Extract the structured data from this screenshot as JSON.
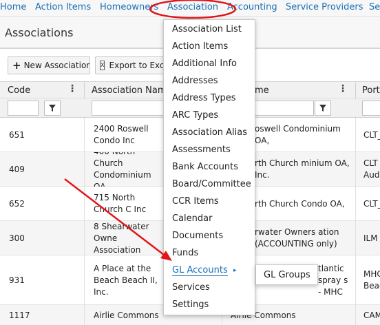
{
  "nav": {
    "items": [
      "Home",
      "Action Items",
      "Homeowners",
      "Association",
      "Accounting",
      "Service Providers",
      "Se"
    ],
    "accent": "#1a6fb5"
  },
  "page": {
    "title": "Associations"
  },
  "toolbar": {
    "new_label": "New Association",
    "export_label": "Export to Exce"
  },
  "table": {
    "columns": [
      "Code",
      "Association Name",
      "me",
      "Port"
    ],
    "rows": [
      {
        "code": "651",
        "name": "2400 Roswell Condo Inc",
        "name2": "oswell Condominium OA,",
        "port": "CLT_"
      },
      {
        "code": "409",
        "name": "400 North Church Condominium OA,",
        "name2": "rth Church minium OA, Inc.",
        "port": "CLT Audi"
      },
      {
        "code": "652",
        "name": "715 North Church C Inc",
        "name2": "rth Church Condo OA,",
        "port": "CLT_"
      },
      {
        "code": "300",
        "name": "8 Shearwater Owne Association",
        "name2": "rwater Owners ation (ACCOUNTING only)",
        "port": "ILM"
      },
      {
        "code": "931",
        "name": "A Place at the Beach Beach II, Inc.",
        "name2": "tlantic spray s - MHC",
        "port": "MHC Beac"
      },
      {
        "code": "1117",
        "name": "Airlie Commons",
        "name2": "Airlie Commons",
        "port": "CAM"
      }
    ]
  },
  "menu": {
    "items": [
      "Association List",
      "Action Items",
      "Additional Info",
      "Addresses",
      "Address Types",
      "ARC Types",
      "Association Alias",
      "Assessments",
      "Bank Accounts",
      "Board/Committee",
      "CCR Items",
      "Calendar",
      "Documents",
      "Funds",
      "GL Accounts",
      "Services",
      "Settings"
    ],
    "active": "GL Accounts",
    "submenu_caret": "▸",
    "submenu": [
      "GL Groups"
    ]
  },
  "annotation_color": "#e0161b"
}
